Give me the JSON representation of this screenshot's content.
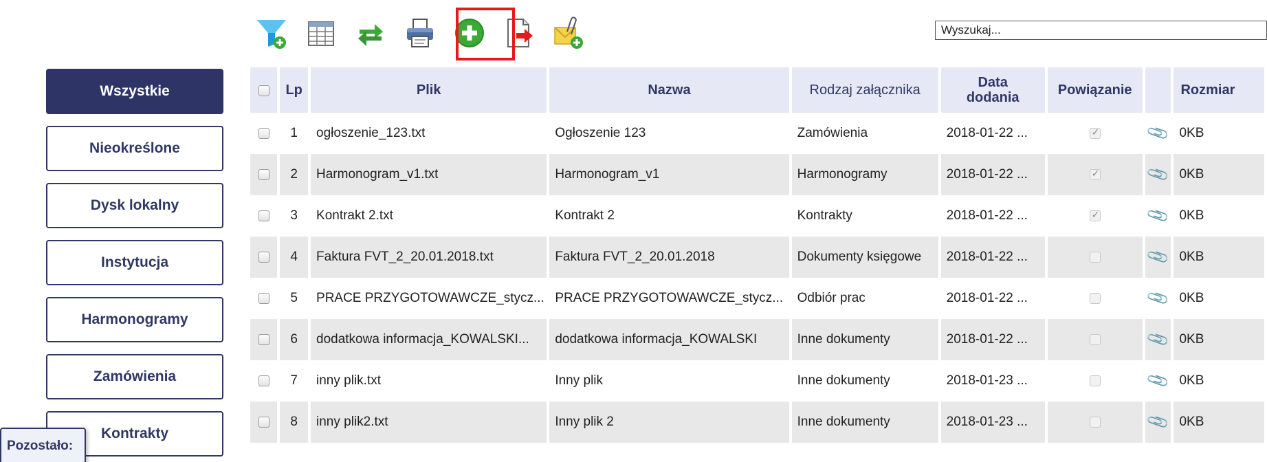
{
  "toolbar": {
    "icons": [
      "filter-add-icon",
      "table-view-icon",
      "refresh-icon",
      "print-icon",
      "add-icon",
      "export-icon",
      "add-attachment-icon"
    ],
    "search_placeholder": "Wyszukaj..."
  },
  "sidebar": {
    "items": [
      {
        "label": "Wszystkie",
        "active": true
      },
      {
        "label": "Nieokreślone"
      },
      {
        "label": "Dysk lokalny"
      },
      {
        "label": "Instytucja"
      },
      {
        "label": "Harmonogramy"
      },
      {
        "label": "Zamówienia"
      },
      {
        "label": "Kontrakty"
      }
    ],
    "remaining_label": "Pozostało:"
  },
  "table": {
    "headers": {
      "lp": "Lp",
      "plik": "Plik",
      "nazwa": "Nazwa",
      "rodzaj": "Rodzaj załącznika",
      "data_line1": "Data",
      "data_line2": "dodania",
      "powiazanie": "Powiązanie",
      "rozmiar": "Rozmiar"
    },
    "rows": [
      {
        "lp": "1",
        "plik": "ogłoszenie_123.txt",
        "nazwa": "Ogłoszenie 123",
        "rodzaj": "Zamówienia",
        "data": "2018-01-22 ...",
        "powiazanie": true,
        "rozmiar": "0KB"
      },
      {
        "lp": "2",
        "plik": "Harmonogram_v1.txt",
        "nazwa": "Harmonogram_v1",
        "rodzaj": "Harmonogramy",
        "data": "2018-01-22 ...",
        "powiazanie": true,
        "rozmiar": "0KB"
      },
      {
        "lp": "3",
        "plik": "Kontrakt 2.txt",
        "nazwa": "Kontrakt 2",
        "rodzaj": "Kontrakty",
        "data": "2018-01-22 ...",
        "powiazanie": true,
        "rozmiar": "0KB"
      },
      {
        "lp": "4",
        "plik": "Faktura FVT_2_20.01.2018.txt",
        "nazwa": "Faktura FVT_2_20.01.2018",
        "rodzaj": "Dokumenty księgowe",
        "data": "2018-01-22 ...",
        "powiazanie": false,
        "rozmiar": "0KB"
      },
      {
        "lp": "5",
        "plik": "PRACE PRZYGOTOWAWCZE_stycz...",
        "nazwa": "PRACE PRZYGOTOWAWCZE_stycz...",
        "rodzaj": "Odbiór prac",
        "data": "2018-01-22 ...",
        "powiazanie": false,
        "rozmiar": "0KB"
      },
      {
        "lp": "6",
        "plik": "dodatkowa informacja_KOWALSKI...",
        "nazwa": "dodatkowa informacja_KOWALSKI",
        "rodzaj": "Inne dokumenty",
        "data": "2018-01-22 ...",
        "powiazanie": false,
        "rozmiar": "0KB"
      },
      {
        "lp": "7",
        "plik": "inny plik.txt",
        "nazwa": "Inny plik",
        "rodzaj": "Inne dokumenty",
        "data": "2018-01-23 ...",
        "powiazanie": false,
        "rozmiar": "0KB"
      },
      {
        "lp": "8",
        "plik": "inny plik2.txt",
        "nazwa": "Inny plik 2",
        "rodzaj": "Inne dokumenty",
        "data": "2018-01-23 ...",
        "powiazanie": false,
        "rozmiar": "0KB"
      }
    ]
  },
  "colors": {
    "accent": "#2e3566",
    "highlight": "#e8191d",
    "add_green": "#3aa935",
    "header_bg": "#e6e9f5"
  }
}
